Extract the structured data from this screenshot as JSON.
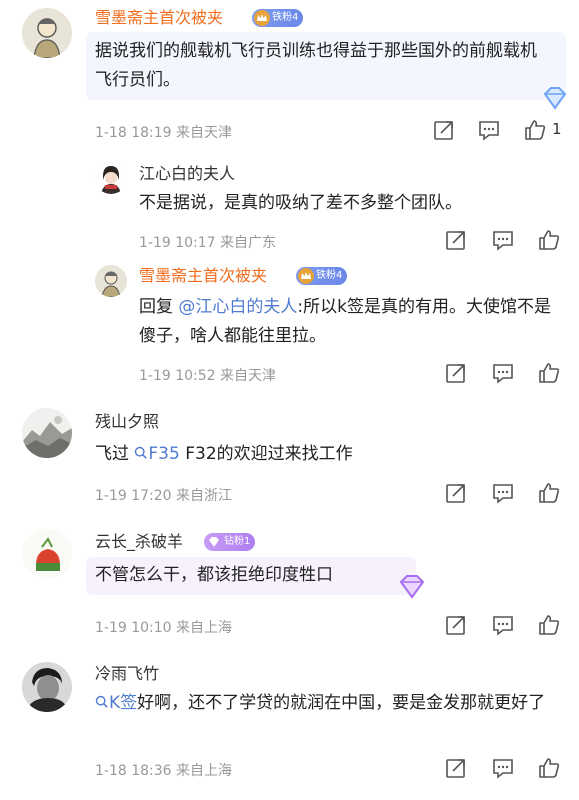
{
  "comments": [
    {
      "user": "雪墨斋主首次被夹",
      "badge": "铁粉4",
      "text": "据说我们的舰载机飞行员训练也得益于那些国外的前舰载机飞行员们。",
      "meta": "1-18 18:19 来自天津",
      "likes": "1"
    },
    {
      "user": "江心白的夫人",
      "text": "不是据说，是真的吸纳了差不多整个团队。",
      "meta": "1-19 10:17 来自广东"
    },
    {
      "user": "雪墨斋主首次被夹",
      "badge": "铁粉4",
      "reply_prefix": "回复",
      "reply_target": "@江心白的夫人",
      "text": ":所以k签是真的有用。大使馆不是傻子，啥人都能往里拉。",
      "meta": "1-19 10:52 来自天津"
    },
    {
      "user": "残山夕照",
      "text_prefix": "飞过",
      "topic": "F35",
      "text": "F32的欢迎过来找工作",
      "meta": "1-19 17:20 来自浙江"
    },
    {
      "user": "云长_杀破羊",
      "badge": "钻粉1",
      "text": "不管怎么干，都该拒绝印度牲口",
      "meta": "1-19 10:10 来自上海"
    },
    {
      "user": "冷雨飞竹",
      "topic": "K签",
      "text": "好啊，还不了学贷的就润在中国，要是金发那就更好了",
      "meta": "1-18 18:36 来自上海"
    }
  ],
  "colors": {
    "orange_name": "#f06e1e",
    "link": "#4f7bd1",
    "meta": "#999999",
    "iron_badge": "#7d9cf0",
    "diamond_badge": "#b586f2"
  },
  "icons": [
    "share-icon",
    "comment-icon",
    "like-icon",
    "search-icon",
    "diamond-icon"
  ]
}
